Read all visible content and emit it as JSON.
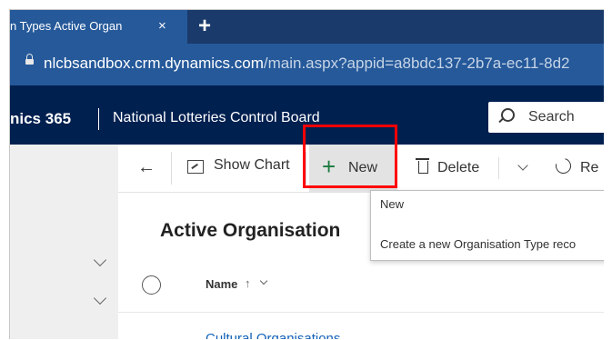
{
  "browser": {
    "tab_title": "n Types Active Organ",
    "tab_close": "×",
    "new_tab": "+",
    "url_host": "nlcbsandbox.crm.dynamics.com",
    "url_path": "/main.aspx?appid=a8bdc137-2b7a-ec11-8d2"
  },
  "app": {
    "name": "nics 365",
    "org": "National Lotteries Control Board",
    "search_label": "Search"
  },
  "commandbar": {
    "back": "←",
    "show_chart": "Show Chart",
    "new_plus": "+",
    "new_label": "New",
    "delete_label": "Delete",
    "refresh_label": "Re"
  },
  "view": {
    "title": "Active Organisation",
    "column_name": "Name",
    "sort_indicator": "↑",
    "rows": [
      "Cultural Organisations"
    ]
  },
  "tooltip": {
    "title": "New",
    "description": "Create a new Organisation Type reco"
  },
  "colors": {
    "tab_active": "#25599a",
    "tab_strip": "#1a3a6b",
    "app_header": "#002050",
    "new_icon": "#1b7a3e",
    "link": "#1160b7",
    "highlight": "#ff0000"
  }
}
